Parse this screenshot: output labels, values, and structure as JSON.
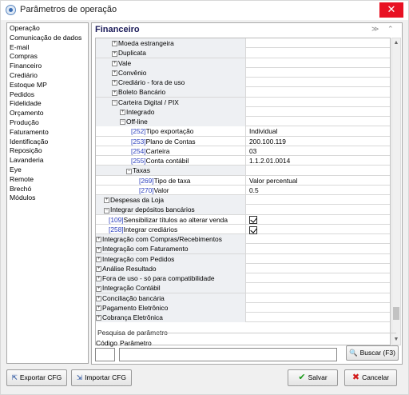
{
  "window": {
    "title": "Parâmetros de operação",
    "close_label": "✕"
  },
  "sidebar": {
    "items": [
      "Operação",
      "Comunicação de dados",
      "E-mail",
      "Compras",
      "Financeiro",
      "Crediário",
      "Estoque MP",
      "Pedidos",
      "Fidelidade",
      "Orçamento",
      "Produção",
      "Faturamento",
      "Identificação",
      "Reposição",
      "Lavanderia",
      "Eye",
      "Remote",
      "Brechó",
      "Módulos"
    ]
  },
  "panel": {
    "title": "Financeiro",
    "collapse_icon": "≫",
    "scroll_up_icon": "⌃"
  },
  "grid": {
    "rows": [
      {
        "indent": 20,
        "exp": "+",
        "code": "",
        "name": "Moeda estrangeira",
        "value": "",
        "check": false
      },
      {
        "indent": 20,
        "exp": "+",
        "code": "",
        "name": "Duplicata",
        "value": "",
        "check": false
      },
      {
        "indent": 20,
        "exp": "+",
        "code": "",
        "name": "Vale",
        "value": "",
        "check": false
      },
      {
        "indent": 20,
        "exp": "+",
        "code": "",
        "name": "Convênio",
        "value": "",
        "check": false
      },
      {
        "indent": 20,
        "exp": "+",
        "code": "",
        "name": "Crediário - fora de uso",
        "value": "",
        "check": false
      },
      {
        "indent": 20,
        "exp": "+",
        "code": "",
        "name": "Boleto Bancário",
        "value": "",
        "check": false
      },
      {
        "indent": 20,
        "exp": "−",
        "code": "",
        "name": "Carteira Digital / PIX",
        "value": "",
        "check": false
      },
      {
        "indent": 30,
        "exp": "+",
        "code": "",
        "name": "Integrado",
        "value": "",
        "check": false
      },
      {
        "indent": 30,
        "exp": "−",
        "code": "",
        "name": "Off-line",
        "value": "",
        "check": false
      },
      {
        "indent": 44,
        "exp": "",
        "code": "[252]",
        "name": "Tipo exportação",
        "value": "Individual",
        "check": false
      },
      {
        "indent": 44,
        "exp": "",
        "code": "[253]",
        "name": "Plano de Contas",
        "value": "200.100.119",
        "check": false
      },
      {
        "indent": 44,
        "exp": "",
        "code": "[254]",
        "name": "Carteira",
        "value": "03",
        "check": false
      },
      {
        "indent": 44,
        "exp": "",
        "code": "[255]",
        "name": "Conta contábil",
        "value": "1.1.2.01.0014",
        "check": false
      },
      {
        "indent": 38,
        "exp": "−",
        "code": "",
        "name": "Taxas",
        "value": "",
        "check": false
      },
      {
        "indent": 54,
        "exp": "",
        "code": "[269]",
        "name": "Tipo de taxa",
        "value": "Valor percentual",
        "check": false
      },
      {
        "indent": 54,
        "exp": "",
        "code": "[270]",
        "name": "Valor",
        "value": "0.5",
        "check": false
      },
      {
        "indent": 10,
        "exp": "+",
        "code": "",
        "name": "Despesas da Loja",
        "value": "",
        "check": false
      },
      {
        "indent": 10,
        "exp": "−",
        "code": "",
        "name": "Integrar depósitos bancários",
        "value": "",
        "check": false
      },
      {
        "indent": 16,
        "exp": "",
        "code": "[109]",
        "name": "Sensibilizar títulos ao alterar venda",
        "value": "",
        "check": true
      },
      {
        "indent": 16,
        "exp": "",
        "code": "[258]",
        "name": "Integrar crediários",
        "value": "",
        "check": true
      },
      {
        "indent": 0,
        "exp": "+",
        "code": "",
        "name": "Integração com Compras/Recebimentos",
        "value": "",
        "check": false
      },
      {
        "indent": 0,
        "exp": "+",
        "code": "",
        "name": "Integração com Faturamento",
        "value": "",
        "check": false
      },
      {
        "indent": 0,
        "exp": "+",
        "code": "",
        "name": "Integração com Pedidos",
        "value": "",
        "check": false
      },
      {
        "indent": 0,
        "exp": "+",
        "code": "",
        "name": "Análise Resultado",
        "value": "",
        "check": false
      },
      {
        "indent": 0,
        "exp": "+",
        "code": "",
        "name": "Fora de uso - só para compatibilidade",
        "value": "",
        "check": false
      },
      {
        "indent": 0,
        "exp": "+",
        "code": "",
        "name": "Integração Contábil",
        "value": "",
        "check": false
      },
      {
        "indent": 0,
        "exp": "+",
        "code": "",
        "name": "Conciliação bancária",
        "value": "",
        "check": false
      },
      {
        "indent": 0,
        "exp": "+",
        "code": "",
        "name": "Pagamento Eletrônico",
        "value": "",
        "check": false
      },
      {
        "indent": 0,
        "exp": "+",
        "code": "",
        "name": "Cobrança Eletrônica",
        "value": "",
        "check": false
      }
    ]
  },
  "search": {
    "legend": "Pesquisa de parâmetro",
    "code_label": "Código",
    "param_label": "Parâmetro",
    "code_value": "",
    "param_value": "",
    "button_label": "Buscar (F3)"
  },
  "footer": {
    "export_label": "Exportar CFG",
    "import_label": "Importar CFG",
    "save_label": "Salvar",
    "cancel_label": "Cancelar"
  }
}
